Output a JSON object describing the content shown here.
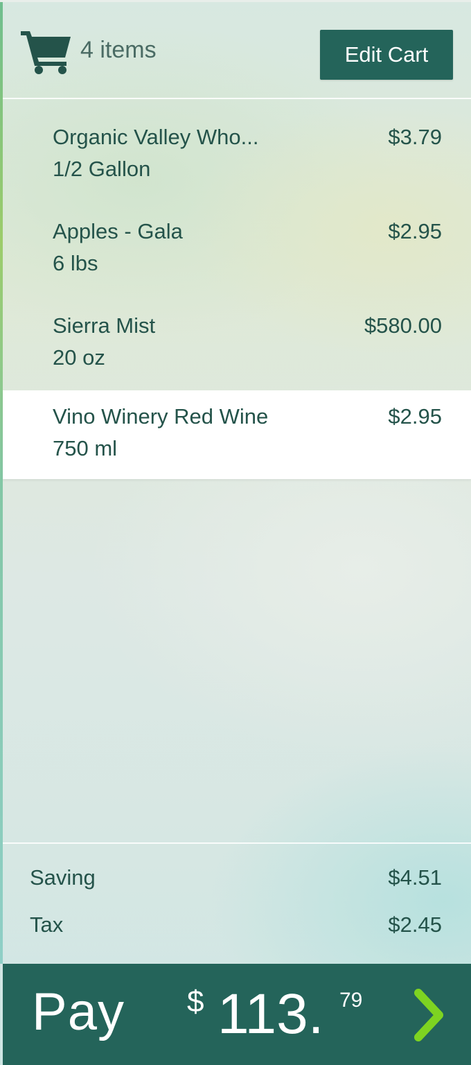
{
  "cart": {
    "count_label": "4 items",
    "edit_label": "Edit Cart"
  },
  "items": [
    {
      "name": "Organic Valley Who...",
      "qty": "1/2 Gallon",
      "price": "$3.79",
      "selected": false
    },
    {
      "name": "Apples - Gala",
      "qty": "6 lbs",
      "price": "$2.95",
      "selected": false
    },
    {
      "name": "Sierra Mist",
      "qty": "20 oz",
      "price": "$580.00",
      "selected": false
    },
    {
      "name": "Vino Winery Red Wine",
      "qty": "750 ml",
      "price": "$2.95",
      "selected": true
    }
  ],
  "summary": {
    "saving_label": "Saving",
    "saving_value": "$4.51",
    "tax_label": "Tax",
    "tax_value": "$2.45"
  },
  "pay": {
    "label": "Pay",
    "currency": "$",
    "amount": "113.",
    "cents": "79"
  },
  "icons": {
    "cart": "shopping-cart-icon",
    "next": "chevron-right-icon"
  },
  "colors": {
    "brand": "#24645a",
    "text": "#24534a",
    "accent": "#7ed321"
  }
}
